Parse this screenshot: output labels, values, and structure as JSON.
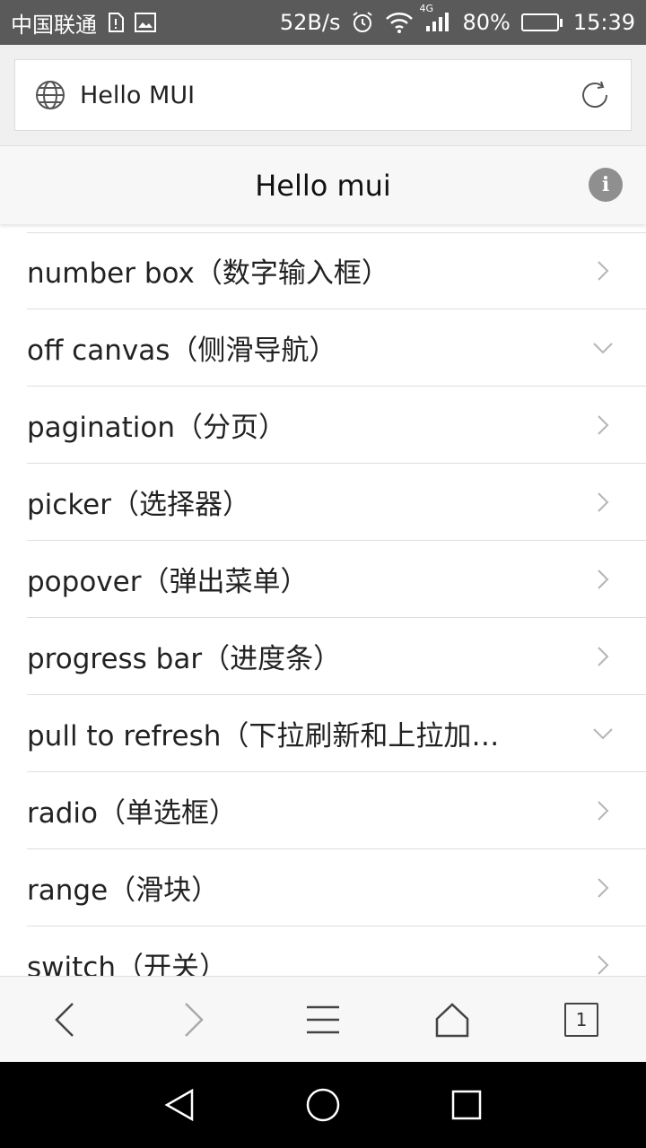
{
  "status_bar": {
    "carrier": "中国联通",
    "speed": "52B/s",
    "network": "4G",
    "battery_percent": "80%",
    "battery_level": 0.8,
    "time": "15:39"
  },
  "url_bar": {
    "url": "Hello MUI"
  },
  "nav_bar": {
    "title": "Hello mui",
    "info_glyph": "i"
  },
  "list": {
    "items": [
      {
        "label": "number box（数字输入框）",
        "indicator": "chevron-right"
      },
      {
        "label": "off canvas（侧滑导航）",
        "indicator": "chevron-down"
      },
      {
        "label": "pagination（分页）",
        "indicator": "chevron-right"
      },
      {
        "label": "picker（选择器）",
        "indicator": "chevron-right"
      },
      {
        "label": "popover（弹出菜单）",
        "indicator": "chevron-right"
      },
      {
        "label": "progress bar（进度条）",
        "indicator": "chevron-right"
      },
      {
        "label": "pull to refresh（下拉刷新和上拉加…",
        "indicator": "chevron-down"
      },
      {
        "label": "radio（单选框）",
        "indicator": "chevron-right"
      },
      {
        "label": "range（滑块）",
        "indicator": "chevron-right"
      },
      {
        "label": "switch（开关）",
        "indicator": "chevron-right"
      }
    ]
  },
  "toolbar": {
    "tab_count": "1"
  },
  "colors": {
    "status_bar_bg": "#5a5a5a",
    "battery_fill": "#7dcb2b",
    "divider": "#dedede",
    "chevron": "#b5b5b5",
    "info_badge": "#8f8f8f"
  }
}
